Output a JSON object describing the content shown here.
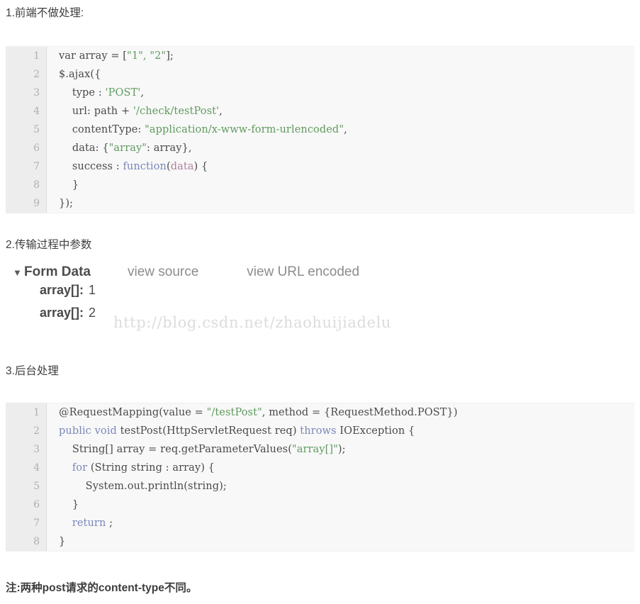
{
  "sections": {
    "frontend_heading": "1.前端不做处理:",
    "transfer_heading": "2.传输过程中参数",
    "backend_heading": "3.后台处理",
    "footer_note": "注:两种post请求的content-type不同。"
  },
  "watermark": "http://blog.csdn.net/zhaohuijiadelu",
  "code_frontend": {
    "language": "javascript",
    "lines": [
      {
        "num": "1",
        "segments": [
          {
            "t": "var array = [",
            "c": "plain"
          },
          {
            "t": "\"1\", \"2\"",
            "c": "string"
          },
          {
            "t": "];",
            "c": "plain"
          }
        ]
      },
      {
        "num": "2",
        "segments": [
          {
            "t": "$.ajax({",
            "c": "plain"
          }
        ]
      },
      {
        "num": "3",
        "segments": [
          {
            "t": "    type : ",
            "c": "plain"
          },
          {
            "t": "'POST'",
            "c": "string"
          },
          {
            "t": ",",
            "c": "plain"
          }
        ]
      },
      {
        "num": "4",
        "segments": [
          {
            "t": "    url: path + ",
            "c": "plain"
          },
          {
            "t": "'/check/testPost'",
            "c": "string"
          },
          {
            "t": ",",
            "c": "plain"
          }
        ]
      },
      {
        "num": "5",
        "segments": [
          {
            "t": "    contentType: ",
            "c": "plain"
          },
          {
            "t": "\"application/x-www-form-urlencoded\"",
            "c": "string"
          },
          {
            "t": ",",
            "c": "plain"
          }
        ]
      },
      {
        "num": "6",
        "segments": [
          {
            "t": "    data: {",
            "c": "plain"
          },
          {
            "t": "\"array\"",
            "c": "string"
          },
          {
            "t": ": array},",
            "c": "plain"
          }
        ]
      },
      {
        "num": "7",
        "segments": [
          {
            "t": "    success : ",
            "c": "plain"
          },
          {
            "t": "function",
            "c": "keyword"
          },
          {
            "t": "(",
            "c": "plain"
          },
          {
            "t": "data",
            "c": "param"
          },
          {
            "t": ") {",
            "c": "plain"
          }
        ]
      },
      {
        "num": "8",
        "segments": [
          {
            "t": "    }",
            "c": "plain"
          }
        ]
      },
      {
        "num": "9",
        "segments": [
          {
            "t": "});",
            "c": "plain"
          }
        ]
      }
    ]
  },
  "form_data": {
    "triangle": "▼",
    "title": "Form Data",
    "view_source_label": "view source",
    "view_url_encoded_label": "view URL encoded",
    "rows": [
      {
        "key": "array[]:",
        "value": "1"
      },
      {
        "key": "array[]:",
        "value": "2"
      }
    ]
  },
  "code_backend": {
    "language": "java",
    "lines": [
      {
        "num": "1",
        "segments": [
          {
            "t": "@RequestMapping(value = ",
            "c": "plain"
          },
          {
            "t": "\"/testPost\"",
            "c": "string"
          },
          {
            "t": ", method = {RequestMethod.POST})",
            "c": "plain"
          }
        ]
      },
      {
        "num": "2",
        "segments": [
          {
            "t": "public",
            "c": "keyword"
          },
          {
            "t": " ",
            "c": "plain"
          },
          {
            "t": "void",
            "c": "keyword"
          },
          {
            "t": " testPost(HttpServletRequest req) ",
            "c": "plain"
          },
          {
            "t": "throws",
            "c": "keyword"
          },
          {
            "t": " IOException {",
            "c": "plain"
          }
        ]
      },
      {
        "num": "3",
        "segments": [
          {
            "t": "    String[] array = req.getParameterValues(",
            "c": "plain"
          },
          {
            "t": "\"array[]\"",
            "c": "string"
          },
          {
            "t": ");",
            "c": "plain"
          }
        ]
      },
      {
        "num": "4",
        "segments": [
          {
            "t": "    ",
            "c": "plain"
          },
          {
            "t": "for",
            "c": "keyword"
          },
          {
            "t": " (String string : array) {",
            "c": "plain"
          }
        ]
      },
      {
        "num": "5",
        "segments": [
          {
            "t": "        System.out.println(string);",
            "c": "plain"
          }
        ]
      },
      {
        "num": "6",
        "segments": [
          {
            "t": "    }",
            "c": "plain"
          }
        ]
      },
      {
        "num": "7",
        "segments": [
          {
            "t": "    ",
            "c": "plain"
          },
          {
            "t": "return",
            "c": "keyword"
          },
          {
            "t": " ;",
            "c": "plain"
          }
        ]
      },
      {
        "num": "8",
        "segments": [
          {
            "t": "}",
            "c": "plain"
          }
        ]
      }
    ]
  },
  "colors": {
    "string": "#5f9a5f",
    "keyword": "#7a86b8",
    "code_bg": "#f8f8f8",
    "gutter_bg": "#ededed",
    "watermark": "#dcdcdc"
  }
}
